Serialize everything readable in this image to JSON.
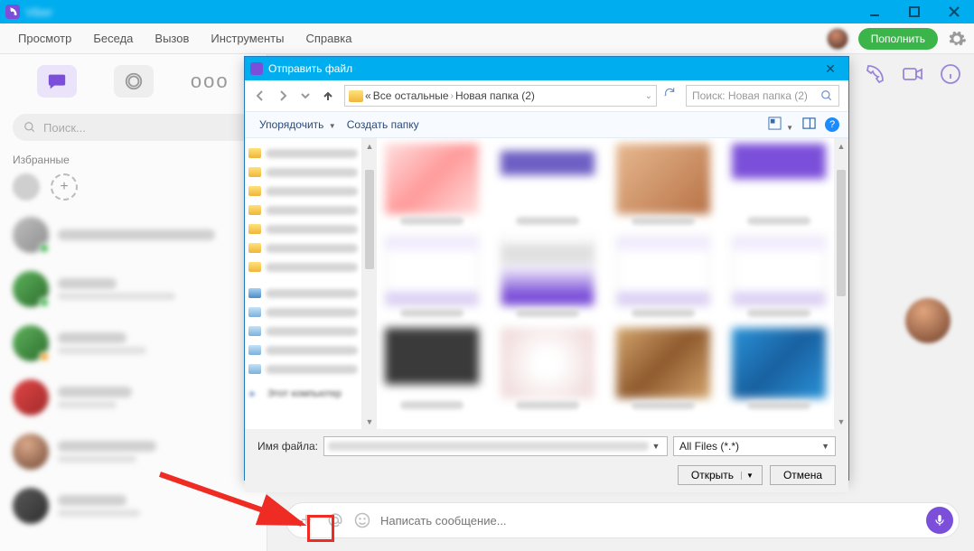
{
  "titlebar": {
    "app_name_blur": "Viber"
  },
  "window_controls": {
    "minimize": "—",
    "maximize": "❐",
    "close": "✕"
  },
  "menubar": {
    "items": [
      "Просмотр",
      "Беседа",
      "Вызов",
      "Инструменты",
      "Справка"
    ],
    "topup": "Пополнить"
  },
  "leftcol": {
    "search_placeholder": "Поиск...",
    "favorites_label": "Избранные"
  },
  "msgbar": {
    "placeholder": "Написать сообщение..."
  },
  "dialog": {
    "title": "Отправить файл",
    "breadcrumb": {
      "a": "«",
      "b": "Все остальные",
      "c": "Новая папка (2)"
    },
    "search_placeholder": "Поиск: Новая папка (2)",
    "toolbar": {
      "organize": "Упорядочить",
      "new_folder": "Создать папку"
    },
    "tree_computer": "Этот компьютер",
    "footer": {
      "filename_label": "Имя файла:",
      "filetype": "All Files (*.*)",
      "open": "Открыть",
      "cancel": "Отмена"
    }
  }
}
